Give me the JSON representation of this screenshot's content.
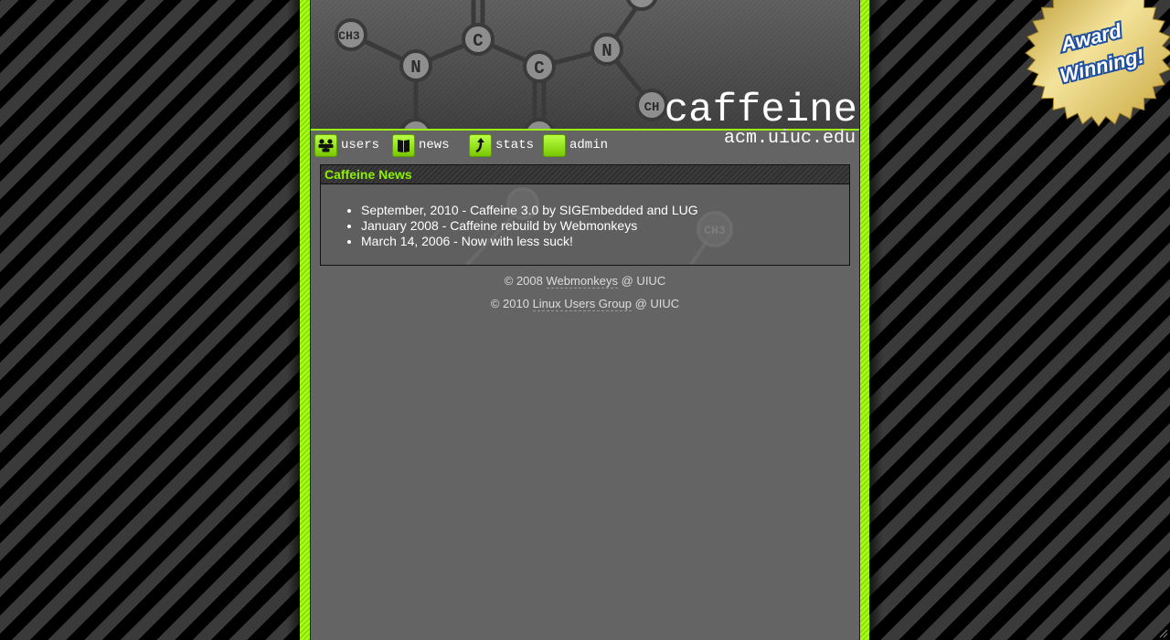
{
  "header": {
    "title": "caffeine",
    "subtitle": "acm.uiuc.edu"
  },
  "molecule": {
    "atoms": [
      "CH3",
      "N",
      "C",
      "C",
      "N",
      "CH",
      "CH3"
    ]
  },
  "nav": {
    "items": [
      {
        "label": "users",
        "icon": "users-icon"
      },
      {
        "label": "news",
        "icon": "news-icon"
      },
      {
        "label": "stats",
        "icon": "stats-icon"
      },
      {
        "label": "admin",
        "icon": "admin-icon"
      }
    ]
  },
  "news": {
    "title": "Caffeine News",
    "items": [
      "September, 2010 - Caffeine 3.0 by SIGEmbedded and LUG",
      "January 2008 - Caffeine rebuild by Webmonkeys",
      "March 14, 2006 - Now with less suck!"
    ]
  },
  "footer": {
    "line1": {
      "prefix": "© 2008 ",
      "link": "Webmonkeys",
      "suffix": " @ UIUC"
    },
    "line2": {
      "prefix": "© 2010 ",
      "link": "Linux Users Group",
      "suffix": " @ UIUC"
    }
  },
  "badge": {
    "line1": "Award",
    "line2": "Winning!"
  },
  "colors": {
    "accent": "#9af20e",
    "news_title": "#8ef000",
    "content_bg": "#646464",
    "badge_gold": "#e6cf6a"
  }
}
